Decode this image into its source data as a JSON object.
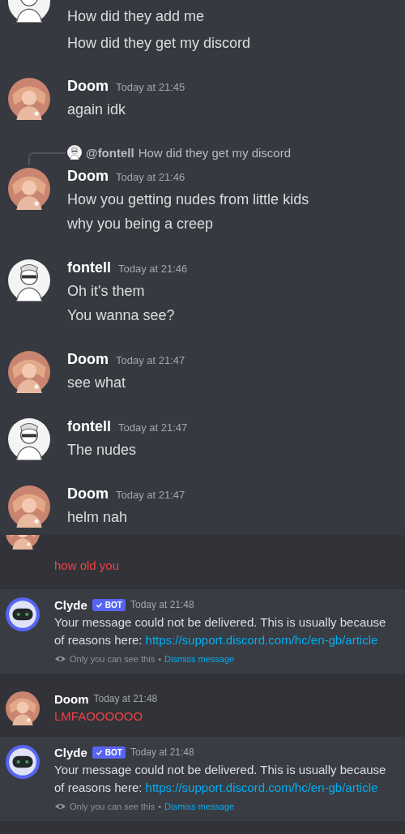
{
  "sections": [
    {
      "messages": [
        {
          "avatar": {
            "kind": "sketch"
          },
          "lines": [
            {
              "text": "How did they add me"
            },
            {
              "text": "How did they get my discord"
            }
          ]
        },
        {
          "author": "Doom",
          "avatar": {
            "kind": "peach"
          },
          "timestamp": "Today at 21:45",
          "lines": [
            {
              "text": "again idk"
            }
          ]
        },
        {
          "author": "Doom",
          "avatar": {
            "kind": "peach"
          },
          "timestamp": "Today at 21:46",
          "reply": {
            "avatar": {
              "kind": "sketch"
            },
            "author": "@fontell",
            "text": "How did they get my discord"
          },
          "lines": [
            {
              "text": "How you getting nudes from little kids"
            },
            {
              "text": "why you being a creep"
            }
          ]
        },
        {
          "author": "fontell",
          "avatar": {
            "kind": "sketch"
          },
          "timestamp": "Today at 21:46",
          "lines": [
            {
              "text": "Oh it's them"
            },
            {
              "text": "You wanna see?"
            }
          ]
        },
        {
          "author": "Doom",
          "avatar": {
            "kind": "peach"
          },
          "timestamp": "Today at 21:47",
          "lines": [
            {
              "text": "see what"
            }
          ]
        },
        {
          "author": "fontell",
          "avatar": {
            "kind": "sketch"
          },
          "timestamp": "Today at 21:47",
          "lines": [
            {
              "text": "The nudes"
            }
          ]
        },
        {
          "author": "Doom",
          "avatar": {
            "kind": "peach"
          },
          "timestamp": "Today at 21:47",
          "lines": [
            {
              "text": "helm nah"
            }
          ]
        }
      ]
    },
    {
      "messages": [
        {
          "avatar": {
            "kind": "peach"
          },
          "lines": [
            {
              "text": "how old you",
              "failed": true
            }
          ]
        },
        {
          "author": "Clyde",
          "badge": "BOT",
          "avatar": {
            "kind": "bot"
          },
          "timestamp": "Today at 21:48",
          "ephemeral": true,
          "lines": [
            {
              "text": "Your message could not be delivered. This is usually because"
            },
            {
              "text": "of reasons here: ",
              "link": "https://support.discord.com/hc/en-gb/article"
            }
          ],
          "footer": {
            "note": "Only you can see this",
            "separator": "•",
            "action": "Dismiss message"
          }
        },
        {
          "author": "Doom",
          "avatar": {
            "kind": "peach"
          },
          "timestamp": "Today at 21:48",
          "lines": [
            {
              "text": "LMFAOOOOOO",
              "failed": true
            }
          ]
        },
        {
          "author": "Clyde",
          "badge": "BOT",
          "avatar": {
            "kind": "bot"
          },
          "timestamp": "Today at 21:48",
          "ephemeral": true,
          "lines": [
            {
              "text": "Your message could not be delivered. This is usually because"
            },
            {
              "text": "of reasons here: ",
              "link": "https://support.discord.com/hc/en-gb/article"
            }
          ],
          "footer": {
            "note": "Only you can see this",
            "separator": "•",
            "action": "Dismiss message"
          }
        }
      ]
    }
  ]
}
